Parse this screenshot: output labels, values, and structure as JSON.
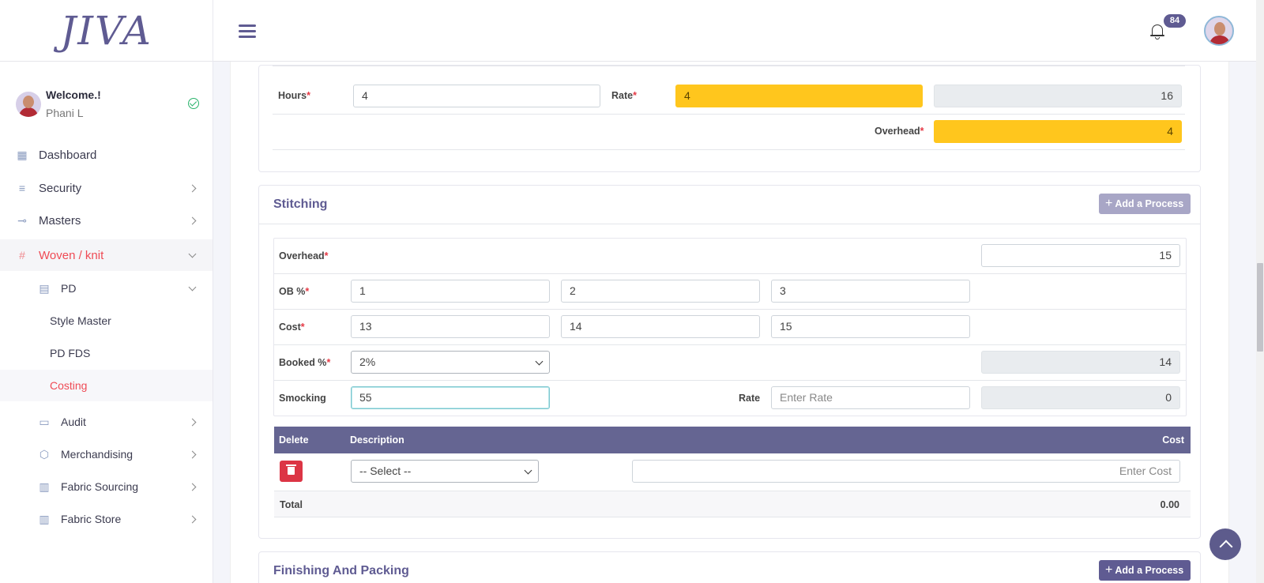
{
  "app": {
    "logo": "JIVA",
    "notifications_count": "84"
  },
  "user": {
    "welcome": "Welcome.!",
    "name": "Phani L"
  },
  "sidebar": {
    "items": [
      {
        "label": "Dashboard",
        "icon": "dashboard-icon"
      },
      {
        "label": "Security",
        "icon": "sliders-icon"
      },
      {
        "label": "Masters",
        "icon": "masters-icon"
      },
      {
        "label": "Woven / knit",
        "icon": "grid-icon"
      },
      {
        "label": "PD",
        "icon": "table-icon"
      },
      {
        "label": "Style Master"
      },
      {
        "label": "PD FDS"
      },
      {
        "label": "Costing"
      },
      {
        "label": "Audit",
        "icon": "audit-icon"
      },
      {
        "label": "Merchandising",
        "icon": "merch-icon"
      },
      {
        "label": "Fabric Sourcing",
        "icon": "fabric-icon"
      },
      {
        "label": "Fabric Store",
        "icon": "store-icon"
      }
    ]
  },
  "top_section": {
    "hours_label": "Hours",
    "hours_value": "4",
    "rate_label": "Rate",
    "rate_value": "4",
    "total_value": "16",
    "overhead_label": "Overhead",
    "overhead_value": "4"
  },
  "stitching": {
    "title": "Stitching",
    "add_button": "Add a Process",
    "overhead_label": "Overhead",
    "overhead_value": "15",
    "ob_label": "OB %",
    "ob_values": [
      "1",
      "2",
      "3"
    ],
    "cost_label": "Cost",
    "cost_values": [
      "13",
      "14",
      "15"
    ],
    "booked_label": "Booked %",
    "booked_selected": "2%",
    "booked_total": "14",
    "smocking_label": "Smocking",
    "smocking_value": "55",
    "smocking_rate_label": "Rate",
    "smocking_rate_placeholder": "Enter Rate",
    "smocking_total": "0",
    "table": {
      "headers": [
        "Delete",
        "Description",
        "Cost"
      ],
      "row_select": "-- Select --",
      "row_cost_placeholder": "Enter Cost",
      "total_label": "Total",
      "total_value": "0.00"
    }
  },
  "finishing": {
    "title": "Finishing And Packing",
    "add_button": "Add a Process"
  }
}
